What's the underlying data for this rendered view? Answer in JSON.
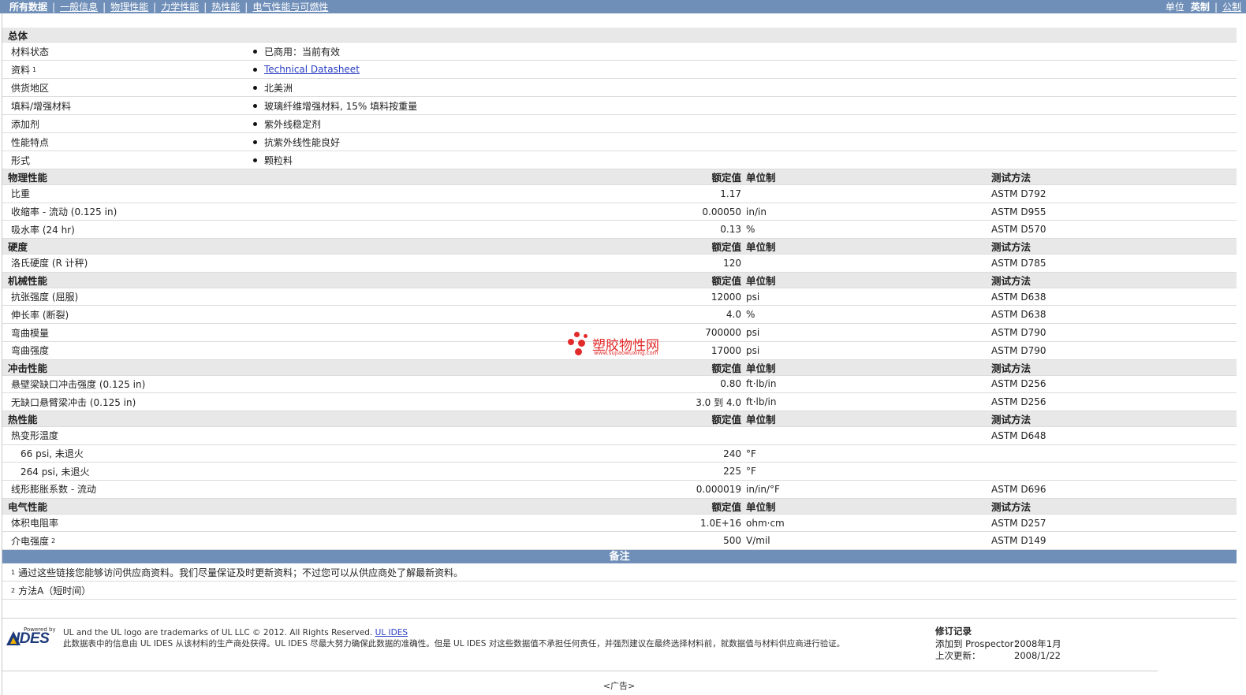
{
  "nav": {
    "tabs": [
      "所有数据",
      "一般信息",
      "物理性能",
      "力学性能",
      "热性能",
      "电气性能与可燃性"
    ],
    "units_label": "单位",
    "units": [
      "英制",
      "公制"
    ]
  },
  "general": {
    "header": "总体",
    "rows": [
      {
        "label": "材料状态",
        "value": "已商用：当前有效"
      },
      {
        "label": "资料",
        "sup": "1",
        "value": "Technical Datasheet",
        "link": true
      },
      {
        "label": "供货地区",
        "value": "北美洲"
      },
      {
        "label": "填料/增强材料",
        "value": "玻璃纤维增强材料, 15% 填料按重量"
      },
      {
        "label": "添加剂",
        "value": "紫外线稳定剂"
      },
      {
        "label": "性能特点",
        "value": "抗紫外线性能良好"
      },
      {
        "label": "形式",
        "value": "颗粒料"
      }
    ]
  },
  "columns": {
    "value": "额定值",
    "unit": "单位制",
    "method": "测试方法"
  },
  "sections": [
    {
      "title": "物理性能",
      "rows": [
        {
          "label": "比重",
          "value": "1.17",
          "unit": "",
          "method": "ASTM D792"
        },
        {
          "label": "收缩率 - 流动 (0.125 in)",
          "value": "0.00050",
          "unit": "in/in",
          "method": "ASTM D955"
        },
        {
          "label": "吸水率 (24 hr)",
          "value": "0.13",
          "unit": "%",
          "method": "ASTM D570"
        }
      ]
    },
    {
      "title": "硬度",
      "rows": [
        {
          "label": "洛氏硬度 (R 计秤)",
          "value": "120",
          "unit": "",
          "method": "ASTM D785"
        }
      ]
    },
    {
      "title": "机械性能",
      "rows": [
        {
          "label": "抗张强度 (屈服)",
          "value": "12000",
          "unit": "psi",
          "method": "ASTM D638"
        },
        {
          "label": "伸长率 (断裂)",
          "value": "4.0",
          "unit": "%",
          "method": "ASTM D638"
        },
        {
          "label": "弯曲模量",
          "value": "700000",
          "unit": "psi",
          "method": "ASTM D790"
        },
        {
          "label": "弯曲强度",
          "value": "17000",
          "unit": "psi",
          "method": "ASTM D790"
        }
      ]
    },
    {
      "title": "冲击性能",
      "rows": [
        {
          "label": "悬壁梁缺口冲击强度 (0.125 in)",
          "value": "0.80",
          "unit": "ft·lb/in",
          "method": "ASTM D256"
        },
        {
          "label": "无缺口悬臂梁冲击 (0.125 in)",
          "value": "3.0 到  4.0",
          "unit": "ft·lb/in",
          "method": "ASTM D256"
        }
      ]
    },
    {
      "title": "热性能",
      "rows": [
        {
          "label": "热变形温度",
          "value": "",
          "unit": "",
          "method": "ASTM D648"
        },
        {
          "label": "66 psi, 未退火",
          "value": "240",
          "unit": "°F",
          "method": "",
          "indent": true
        },
        {
          "label": "264 psi, 未退火",
          "value": "225",
          "unit": "°F",
          "method": "",
          "indent": true
        },
        {
          "label": "线形膨胀系数 - 流动",
          "value": "0.000019",
          "unit": "in/in/°F",
          "method": "ASTM D696"
        }
      ]
    },
    {
      "title": "电气性能",
      "rows": [
        {
          "label": "体积电阻率",
          "value": "1.0E+16",
          "unit": "ohm·cm",
          "method": "ASTM D257"
        },
        {
          "label": "介电强度",
          "sup": "2",
          "value": "500",
          "unit": "V/mil",
          "method": "ASTM D149"
        }
      ]
    }
  ],
  "notes": {
    "title": "备注",
    "items": [
      {
        "num": "1",
        "text": "通过这些链接您能够访问供应商资料。我们尽量保证及时更新资料；不过您可以从供应商处了解最新资料。"
      },
      {
        "num": "2",
        "text": "方法A（短时间）"
      }
    ]
  },
  "footer": {
    "logo_powered": "Powered by",
    "logo_text": "IDES",
    "legal_line1": "UL and the UL logo are trademarks of UL LLC © 2012. All Rights Reserved.",
    "legal_link": "UL IDES",
    "legal_line2": "此数据表中的信息由  UL IDES 从该材料的生产商处获得。UL IDES 尽最大努力确保此数据的准确性。但是  UL IDES 对这些数据值不承担任何责任，并强烈建议在最终选择材料前，就数据值与材料供应商进行验证。",
    "revision_title": "修订记录",
    "added_label": "添加到 Prospector：",
    "added_value": "2008年1月",
    "updated_label": "上次更新：",
    "updated_value": "2008/1/22",
    "ad": "<广告>"
  },
  "watermark": {
    "text": "塑胶物性网",
    "url": "www.sujiaowuxing.com",
    "color": "#e32a2a"
  },
  "colors": {
    "nav": "#6f8fb9",
    "header_bg": "#e8e8e8",
    "link": "#2a3ec2"
  }
}
